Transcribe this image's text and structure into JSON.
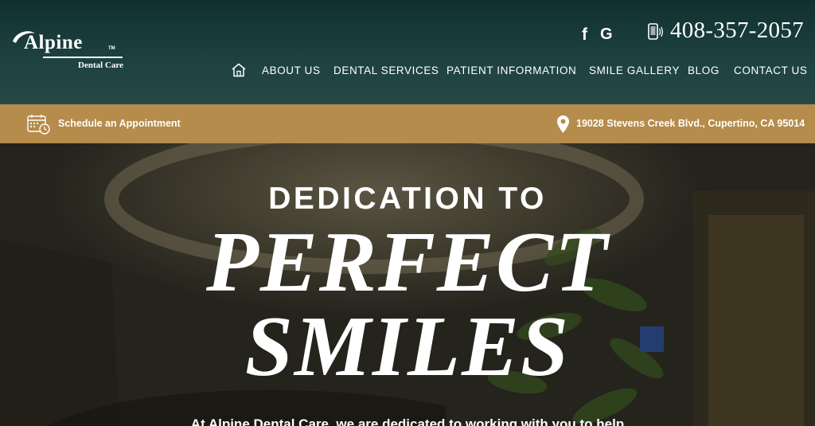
{
  "brand": {
    "name": "Alpine",
    "trademark": "TM",
    "subtitle": "Dental Care"
  },
  "social": {
    "facebook_glyph": "f",
    "google_glyph": "G"
  },
  "contact": {
    "phone": "408-357-2057",
    "address": "19028 Stevens Creek Blvd., Cupertino, CA 95014",
    "appointment_label": "Schedule an Appointment"
  },
  "nav": {
    "home_icon": "home-icon",
    "items": [
      {
        "label": "ABOUT US"
      },
      {
        "label": "DENTAL SERVICES"
      },
      {
        "label": "PATIENT INFORMATION"
      },
      {
        "label": "SMILE GALLERY"
      },
      {
        "label": "BLOG"
      },
      {
        "label": "CONTACT US"
      }
    ]
  },
  "hero": {
    "kicker": "DEDICATION TO",
    "line1": "PERFECT",
    "line2": "SMILES",
    "body": "At Alpine Dental Care, we are dedicated to working with you to help"
  },
  "colors": {
    "header_top": "#10302f",
    "header_bottom": "#264947",
    "gold_bar": "#b58c4b",
    "text": "#ffffff"
  }
}
